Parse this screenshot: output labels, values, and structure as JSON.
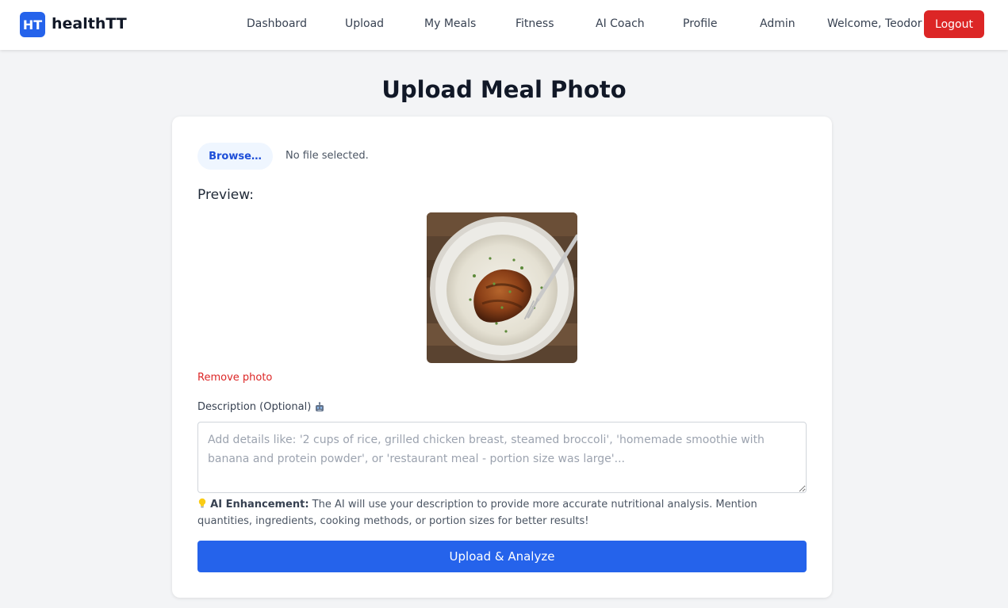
{
  "header": {
    "logo_mark": "HT",
    "logo_text": "healthTT",
    "nav": [
      "Dashboard",
      "Upload",
      "My Meals",
      "Fitness",
      "AI Coach",
      "Profile",
      "Admin"
    ],
    "welcome": "Welcome, Teodor",
    "logout_label": "Logout"
  },
  "page": {
    "title": "Upload Meal Photo"
  },
  "upload": {
    "browse_label": "Browse…",
    "file_status": "No file selected.",
    "preview_label": "Preview:",
    "preview_image": "food-photo",
    "remove_label": "Remove photo",
    "description_label": "Description (Optional)",
    "description_icon": "robot-icon",
    "description_placeholder": "Add details like: '2 cups of rice, grilled chicken breast, steamed broccoli', 'homemade smoothie with banana and protein powder', or 'restaurant meal - portion size was large'...",
    "description_value": "",
    "hint_icon": "lightbulb-icon",
    "hint_title": "AI Enhancement:",
    "hint_text": " The AI will use your description to provide more accurate nutritional analysis. Mention quantities, ingredients, cooking methods, or portion sizes for better results!",
    "submit_label": "Upload & Analyze"
  },
  "colors": {
    "primary": "#2563eb",
    "danger": "#dc2626",
    "background": "#f3f4f6"
  }
}
